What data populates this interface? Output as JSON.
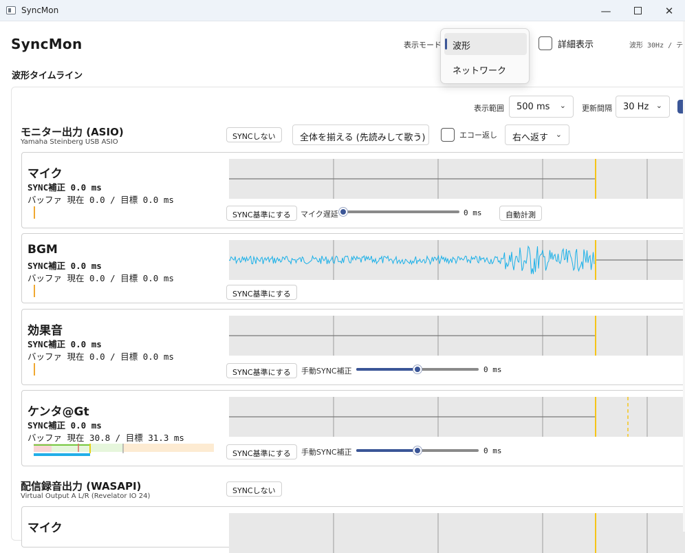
{
  "window": {
    "title": "SyncMon",
    "minimize_glyph": "—",
    "close_glyph": "✕"
  },
  "header": {
    "app_title": "SyncMon",
    "mode_label": "表示モード",
    "mode_options": [
      "波形",
      "ネットワーク"
    ],
    "mode_selected": "波形",
    "detail_label": "詳細表示",
    "wave_info": "波形 30Hz / テ"
  },
  "timeline": {
    "section_title": "波形タイムライン",
    "range_label": "表示範囲",
    "range_value": "500 ms",
    "interval_label": "更新間隔",
    "interval_value": "30 Hz",
    "chevron": "⌄"
  },
  "devices": [
    {
      "name": "モニター出力 (ASIO)",
      "sub": "Yamaha Steinberg USB ASIO",
      "sync_button": "SYNCしない",
      "align_option": "全体を揃える (先読みして歌う)",
      "echo_label": "エコー返し",
      "return_option": "右へ返す",
      "channels": [
        {
          "name": "マイク",
          "sync": "SYNC補正 0.0 ms",
          "buffer": "バッファ 現在 0.0 / 目標 0.0 ms",
          "base_button": "SYNC基準にする",
          "slider_label": "マイク遅延",
          "slider_value": 0,
          "value_text": "0 ms",
          "extra_button": "自動計測"
        },
        {
          "name": "BGM",
          "sync": "SYNC補正 0.0 ms",
          "buffer": "バッファ 現在 0.0 / 目標 0.0 ms",
          "base_button": "SYNC基準にする"
        },
        {
          "name": "効果音",
          "sync": "SYNC補正 0.0 ms",
          "buffer": "バッファ 現在 0.0 / 目標 0.0 ms",
          "base_button": "SYNC基準にする",
          "slider_label": "手動SYNC補正",
          "slider_value": 0,
          "value_text": "0 ms"
        },
        {
          "name": "ケンタ@Gt",
          "sync": "SYNC補正 0.0 ms",
          "buffer": "バッファ 現在 30.8 / 目標 31.3 ms",
          "base_button": "SYNC基準にする",
          "slider_label": "手動SYNC補正",
          "slider_value": 0,
          "value_text": "0 ms"
        }
      ]
    },
    {
      "name": "配信録音出力 (WASAPI)",
      "sub": "Virtual Output A L/R (Revelator IO 24)",
      "sync_button": "SYNCしない",
      "channels": [
        {
          "name": "マイク"
        }
      ]
    }
  ],
  "colors": {
    "accent": "#3b5697",
    "wave": "#1ab0e8",
    "marker": "#f5c518",
    "meter": "#f0a830"
  }
}
